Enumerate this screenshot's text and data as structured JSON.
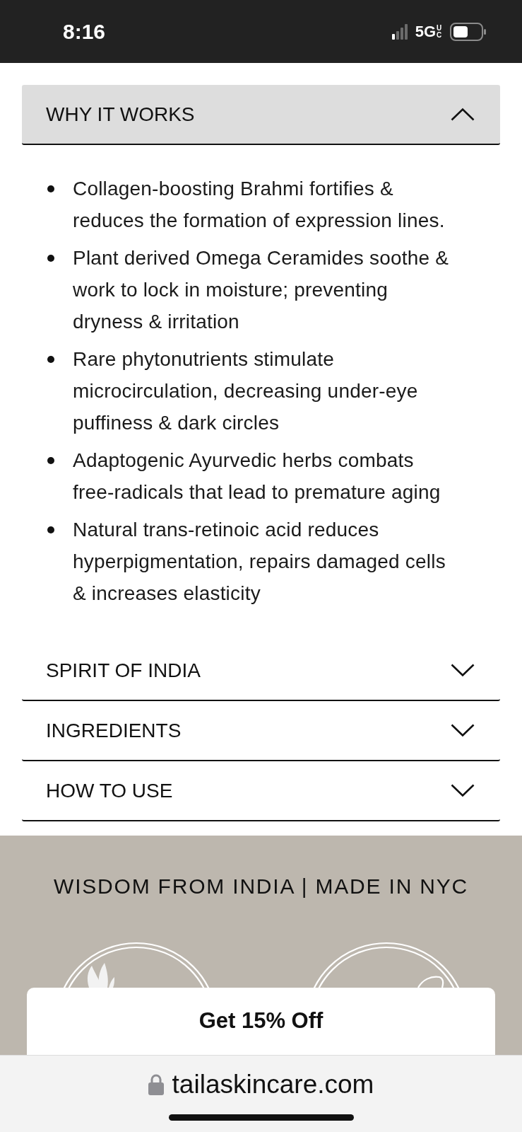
{
  "status_bar": {
    "time": "8:16",
    "network": "5G",
    "network_suffix": "UC"
  },
  "accordion": [
    {
      "title": "WHY IT WORKS",
      "expanded": true,
      "bullets": [
        "Collagen-boosting Brahmi fortifies & reduces the formation of expression lines.",
        "Plant derived Omega Ceramides soothe & work to lock in moisture; preventing dryness & irritation",
        "Rare phytonutrients stimulate microcirculation, decreasing under-eye puffiness & dark circles",
        "Adaptogenic Ayurvedic herbs combats free-radicals that lead to premature aging",
        "Natural trans-retinoic acid reduces hyperpigmentation, repairs damaged cells & increases elasticity"
      ]
    },
    {
      "title": "SPIRIT OF INDIA",
      "expanded": false
    },
    {
      "title": "INGREDIENTS",
      "expanded": false
    },
    {
      "title": "HOW TO USE",
      "expanded": false
    }
  ],
  "banner": {
    "title": "WISDOM FROM INDIA | MADE IN NYC"
  },
  "popup": {
    "label": "Get 15% Off"
  },
  "browser": {
    "url": "tailaskincare.com"
  }
}
